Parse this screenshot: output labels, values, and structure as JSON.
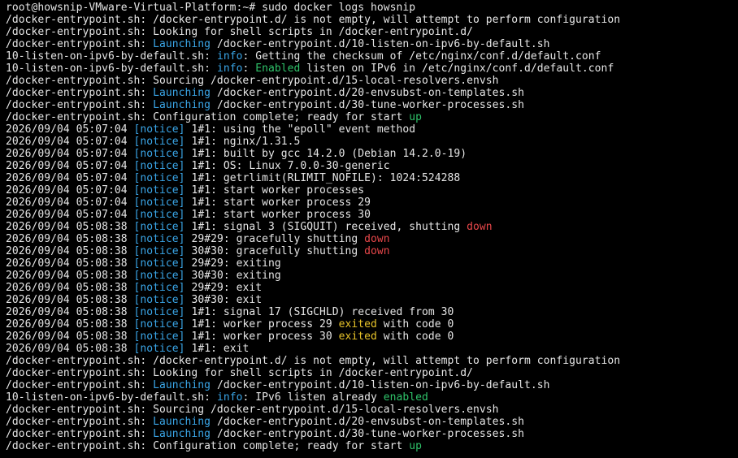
{
  "window": {
    "title": "",
    "background": "#000000"
  },
  "colors": {
    "default": "#e6e6e6",
    "cyan": "#3aa6e8",
    "green": "#2fc36a",
    "red": "#e8474a",
    "yellow": "#e6c229"
  },
  "lines": [
    [
      {
        "t": "root@howsnip-VMware-Virtual-Platform:~# sudo docker logs howsnip"
      }
    ],
    [
      {
        "t": "/docker-entrypoint.sh: /docker-entrypoint.d/ is not empty, will attempt to perform configuration"
      }
    ],
    [
      {
        "t": "/docker-entrypoint.sh: Looking for shell scripts in /docker-entrypoint.d/"
      }
    ],
    [
      {
        "t": "/docker-entrypoint.sh: "
      },
      {
        "t": "Launching",
        "c": "cyan"
      },
      {
        "t": " /docker-entrypoint.d/10-listen-on-ipv6-by-default.sh"
      }
    ],
    [
      {
        "t": "10-listen-on-ipv6-by-default.sh: "
      },
      {
        "t": "info",
        "c": "cyan"
      },
      {
        "t": ": Getting the checksum of /etc/nginx/conf.d/default.conf"
      }
    ],
    [
      {
        "t": "10-listen-on-ipv6-by-default.sh: "
      },
      {
        "t": "info",
        "c": "cyan"
      },
      {
        "t": ": "
      },
      {
        "t": "Enabled",
        "c": "green"
      },
      {
        "t": " listen on IPv6 in /etc/nginx/conf.d/default.conf"
      }
    ],
    [
      {
        "t": "/docker-entrypoint.sh: Sourcing /docker-entrypoint.d/15-local-resolvers.envsh"
      }
    ],
    [
      {
        "t": "/docker-entrypoint.sh: "
      },
      {
        "t": "Launching",
        "c": "cyan"
      },
      {
        "t": " /docker-entrypoint.d/20-envsubst-on-templates.sh"
      }
    ],
    [
      {
        "t": "/docker-entrypoint.sh: "
      },
      {
        "t": "Launching",
        "c": "cyan"
      },
      {
        "t": " /docker-entrypoint.d/30-tune-worker-processes.sh"
      }
    ],
    [
      {
        "t": "/docker-entrypoint.sh: Configuration complete; ready for start "
      },
      {
        "t": "up",
        "c": "green"
      }
    ],
    [
      {
        "t": "2026/09/04 05:07:04 "
      },
      {
        "t": "[notice]",
        "c": "cyan"
      },
      {
        "t": " 1#1: using the \"epoll\" event method"
      }
    ],
    [
      {
        "t": "2026/09/04 05:07:04 "
      },
      {
        "t": "[notice]",
        "c": "cyan"
      },
      {
        "t": " 1#1: nginx/1.31.5"
      }
    ],
    [
      {
        "t": "2026/09/04 05:07:04 "
      },
      {
        "t": "[notice]",
        "c": "cyan"
      },
      {
        "t": " 1#1: built by gcc 14.2.0 (Debian 14.2.0-19)"
      }
    ],
    [
      {
        "t": "2026/09/04 05:07:04 "
      },
      {
        "t": "[notice]",
        "c": "cyan"
      },
      {
        "t": " 1#1: OS: Linux 7.0.0-30-generic"
      }
    ],
    [
      {
        "t": "2026/09/04 05:07:04 "
      },
      {
        "t": "[notice]",
        "c": "cyan"
      },
      {
        "t": " 1#1: getrlimit(RLIMIT_NOFILE): 1024:524288"
      }
    ],
    [
      {
        "t": "2026/09/04 05:07:04 "
      },
      {
        "t": "[notice]",
        "c": "cyan"
      },
      {
        "t": " 1#1: start worker processes"
      }
    ],
    [
      {
        "t": "2026/09/04 05:07:04 "
      },
      {
        "t": "[notice]",
        "c": "cyan"
      },
      {
        "t": " 1#1: start worker process 29"
      }
    ],
    [
      {
        "t": "2026/09/04 05:07:04 "
      },
      {
        "t": "[notice]",
        "c": "cyan"
      },
      {
        "t": " 1#1: start worker process 30"
      }
    ],
    [
      {
        "t": "2026/09/04 05:08:38 "
      },
      {
        "t": "[notice]",
        "c": "cyan"
      },
      {
        "t": " 1#1: signal 3 (SIGQUIT) received, shutting "
      },
      {
        "t": "down",
        "c": "red"
      }
    ],
    [
      {
        "t": "2026/09/04 05:08:38 "
      },
      {
        "t": "[notice]",
        "c": "cyan"
      },
      {
        "t": " 29#29: gracefully shutting "
      },
      {
        "t": "down",
        "c": "red"
      }
    ],
    [
      {
        "t": "2026/09/04 05:08:38 "
      },
      {
        "t": "[notice]",
        "c": "cyan"
      },
      {
        "t": " 30#30: gracefully shutting "
      },
      {
        "t": "down",
        "c": "red"
      }
    ],
    [
      {
        "t": "2026/09/04 05:08:38 "
      },
      {
        "t": "[notice]",
        "c": "cyan"
      },
      {
        "t": " 29#29: exiting"
      }
    ],
    [
      {
        "t": "2026/09/04 05:08:38 "
      },
      {
        "t": "[notice]",
        "c": "cyan"
      },
      {
        "t": " 30#30: exiting"
      }
    ],
    [
      {
        "t": "2026/09/04 05:08:38 "
      },
      {
        "t": "[notice]",
        "c": "cyan"
      },
      {
        "t": " 29#29: exit"
      }
    ],
    [
      {
        "t": "2026/09/04 05:08:38 "
      },
      {
        "t": "[notice]",
        "c": "cyan"
      },
      {
        "t": " 30#30: exit"
      }
    ],
    [
      {
        "t": "2026/09/04 05:08:38 "
      },
      {
        "t": "[notice]",
        "c": "cyan"
      },
      {
        "t": " 1#1: signal 17 (SIGCHLD) received from 30"
      }
    ],
    [
      {
        "t": "2026/09/04 05:08:38 "
      },
      {
        "t": "[notice]",
        "c": "cyan"
      },
      {
        "t": " 1#1: worker process 29 "
      },
      {
        "t": "exited",
        "c": "yellow"
      },
      {
        "t": " with code 0"
      }
    ],
    [
      {
        "t": "2026/09/04 05:08:38 "
      },
      {
        "t": "[notice]",
        "c": "cyan"
      },
      {
        "t": " 1#1: worker process 30 "
      },
      {
        "t": "exited",
        "c": "yellow"
      },
      {
        "t": " with code 0"
      }
    ],
    [
      {
        "t": "2026/09/04 05:08:38 "
      },
      {
        "t": "[notice]",
        "c": "cyan"
      },
      {
        "t": " 1#1: exit"
      }
    ],
    [
      {
        "t": "/docker-entrypoint.sh: /docker-entrypoint.d/ is not empty, will attempt to perform configuration"
      }
    ],
    [
      {
        "t": "/docker-entrypoint.sh: Looking for shell scripts in /docker-entrypoint.d/"
      }
    ],
    [
      {
        "t": "/docker-entrypoint.sh: "
      },
      {
        "t": "Launching",
        "c": "cyan"
      },
      {
        "t": " /docker-entrypoint.d/10-listen-on-ipv6-by-default.sh"
      }
    ],
    [
      {
        "t": "10-listen-on-ipv6-by-default.sh: "
      },
      {
        "t": "info",
        "c": "cyan"
      },
      {
        "t": ": IPv6 listen already "
      },
      {
        "t": "enabled",
        "c": "green"
      }
    ],
    [
      {
        "t": "/docker-entrypoint.sh: Sourcing /docker-entrypoint.d/15-local-resolvers.envsh"
      }
    ],
    [
      {
        "t": "/docker-entrypoint.sh: "
      },
      {
        "t": "Launching",
        "c": "cyan"
      },
      {
        "t": " /docker-entrypoint.d/20-envsubst-on-templates.sh"
      }
    ],
    [
      {
        "t": "/docker-entrypoint.sh: "
      },
      {
        "t": "Launching",
        "c": "cyan"
      },
      {
        "t": " /docker-entrypoint.d/30-tune-worker-processes.sh"
      }
    ],
    [
      {
        "t": "/docker-entrypoint.sh: Configuration complete; ready for start "
      },
      {
        "t": "up",
        "c": "green"
      }
    ]
  ]
}
